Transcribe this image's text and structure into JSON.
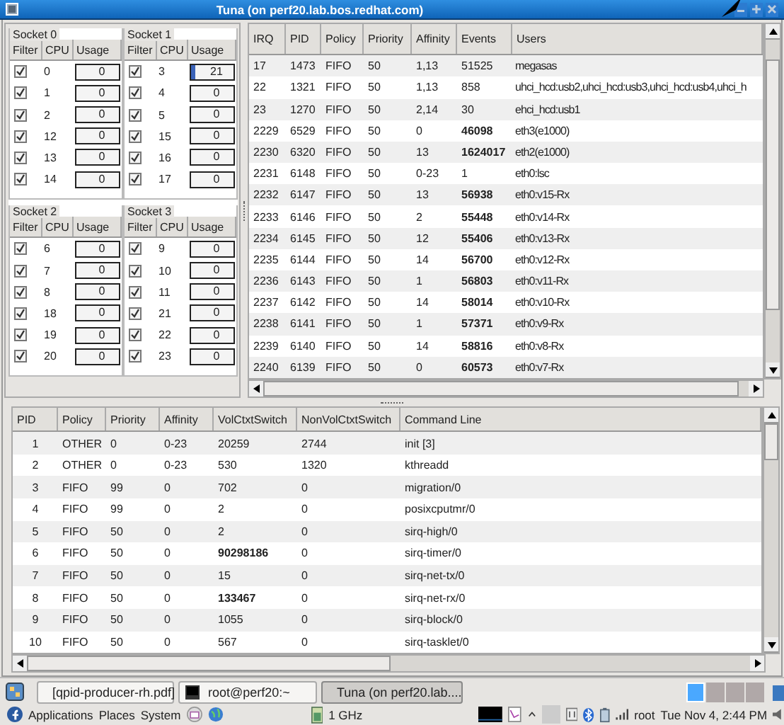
{
  "window": {
    "title": "Tuna (on perf20.lab.bos.redhat.com)"
  },
  "sockets": [
    {
      "label": "Socket 0",
      "columns": [
        "Filter",
        "CPU",
        "Usage"
      ],
      "cpus": [
        {
          "checked": true,
          "cpu": "0",
          "usage": "0"
        },
        {
          "checked": true,
          "cpu": "1",
          "usage": "0"
        },
        {
          "checked": true,
          "cpu": "2",
          "usage": "0"
        },
        {
          "checked": true,
          "cpu": "12",
          "usage": "0"
        },
        {
          "checked": true,
          "cpu": "13",
          "usage": "0"
        },
        {
          "checked": true,
          "cpu": "14",
          "usage": "0"
        }
      ]
    },
    {
      "label": "Socket 1",
      "columns": [
        "Filter",
        "CPU",
        "Usage"
      ],
      "cpus": [
        {
          "checked": true,
          "cpu": "3",
          "usage": "21"
        },
        {
          "checked": true,
          "cpu": "4",
          "usage": "0"
        },
        {
          "checked": true,
          "cpu": "5",
          "usage": "0"
        },
        {
          "checked": true,
          "cpu": "15",
          "usage": "0"
        },
        {
          "checked": true,
          "cpu": "16",
          "usage": "0"
        },
        {
          "checked": true,
          "cpu": "17",
          "usage": "0"
        }
      ]
    },
    {
      "label": "Socket 2",
      "columns": [
        "Filter",
        "CPU",
        "Usage"
      ],
      "cpus": [
        {
          "checked": true,
          "cpu": "6",
          "usage": "0"
        },
        {
          "checked": true,
          "cpu": "7",
          "usage": "0"
        },
        {
          "checked": true,
          "cpu": "8",
          "usage": "0"
        },
        {
          "checked": true,
          "cpu": "18",
          "usage": "0"
        },
        {
          "checked": true,
          "cpu": "19",
          "usage": "0"
        },
        {
          "checked": true,
          "cpu": "20",
          "usage": "0"
        }
      ]
    },
    {
      "label": "Socket 3",
      "columns": [
        "Filter",
        "CPU",
        "Usage"
      ],
      "cpus": [
        {
          "checked": true,
          "cpu": "9",
          "usage": "0"
        },
        {
          "checked": true,
          "cpu": "10",
          "usage": "0"
        },
        {
          "checked": true,
          "cpu": "11",
          "usage": "0"
        },
        {
          "checked": true,
          "cpu": "21",
          "usage": "0"
        },
        {
          "checked": true,
          "cpu": "22",
          "usage": "0"
        },
        {
          "checked": true,
          "cpu": "23",
          "usage": "0"
        }
      ]
    }
  ],
  "irq_table": {
    "columns": [
      "IRQ",
      "PID",
      "Policy",
      "Priority",
      "Affinity",
      "Events",
      "Users"
    ],
    "rows": [
      {
        "cells": [
          "17",
          "1473",
          "FIFO",
          "50",
          "1,13",
          "51525",
          "megasas"
        ],
        "hot": false
      },
      {
        "cells": [
          "22",
          "1321",
          "FIFO",
          "50",
          "1,13",
          "858",
          "uhci_hcd:usb2,uhci_hcd:usb3,uhci_hcd:usb4,uhci_h"
        ],
        "hot": false
      },
      {
        "cells": [
          "23",
          "1270",
          "FIFO",
          "50",
          "2,14",
          "30",
          "ehci_hcd:usb1"
        ],
        "hot": false
      },
      {
        "cells": [
          "2229",
          "6529",
          "FIFO",
          "50",
          "0",
          "46098",
          "eth3(e1000)"
        ],
        "hot": true
      },
      {
        "cells": [
          "2230",
          "6320",
          "FIFO",
          "50",
          "13",
          "1624017",
          "eth2(e1000)"
        ],
        "hot": true
      },
      {
        "cells": [
          "2231",
          "6148",
          "FIFO",
          "50",
          "0-23",
          "1",
          "eth0:lsc"
        ],
        "hot": false
      },
      {
        "cells": [
          "2232",
          "6147",
          "FIFO",
          "50",
          "13",
          "56938",
          "eth0:v15-Rx"
        ],
        "hot": true
      },
      {
        "cells": [
          "2233",
          "6146",
          "FIFO",
          "50",
          "2",
          "55448",
          "eth0:v14-Rx"
        ],
        "hot": true
      },
      {
        "cells": [
          "2234",
          "6145",
          "FIFO",
          "50",
          "12",
          "55406",
          "eth0:v13-Rx"
        ],
        "hot": true
      },
      {
        "cells": [
          "2235",
          "6144",
          "FIFO",
          "50",
          "14",
          "56700",
          "eth0:v12-Rx"
        ],
        "hot": true
      },
      {
        "cells": [
          "2236",
          "6143",
          "FIFO",
          "50",
          "1",
          "56803",
          "eth0:v11-Rx"
        ],
        "hot": true
      },
      {
        "cells": [
          "2237",
          "6142",
          "FIFO",
          "50",
          "14",
          "58014",
          "eth0:v10-Rx"
        ],
        "hot": true
      },
      {
        "cells": [
          "2238",
          "6141",
          "FIFO",
          "50",
          "1",
          "57371",
          "eth0:v9-Rx"
        ],
        "hot": true
      },
      {
        "cells": [
          "2239",
          "6140",
          "FIFO",
          "50",
          "14",
          "58816",
          "eth0:v8-Rx"
        ],
        "hot": true
      },
      {
        "cells": [
          "2240",
          "6139",
          "FIFO",
          "50",
          "0",
          "60573",
          "eth0:v7-Rx"
        ],
        "hot": true
      }
    ]
  },
  "process_table": {
    "columns": [
      "PID",
      "Policy",
      "Priority",
      "Affinity",
      "VolCtxtSwitch",
      "NonVolCtxtSwitch",
      "Command Line"
    ],
    "rows": [
      {
        "cells": [
          "1",
          "OTHER",
          "0",
          "0-23",
          "20259",
          "2744",
          "init [3]"
        ],
        "hot": false
      },
      {
        "cells": [
          "2",
          "OTHER",
          "0",
          "0-23",
          "530",
          "1320",
          "kthreadd"
        ],
        "hot": false
      },
      {
        "cells": [
          "3",
          "FIFO",
          "99",
          "0",
          "702",
          "0",
          "migration/0"
        ],
        "hot": false
      },
      {
        "cells": [
          "4",
          "FIFO",
          "99",
          "0",
          "2",
          "0",
          "posixcputmr/0"
        ],
        "hot": false
      },
      {
        "cells": [
          "5",
          "FIFO",
          "50",
          "0",
          "2",
          "0",
          "sirq-high/0"
        ],
        "hot": false
      },
      {
        "cells": [
          "6",
          "FIFO",
          "50",
          "0",
          "90298186",
          "0",
          "sirq-timer/0"
        ],
        "hot": true
      },
      {
        "cells": [
          "7",
          "FIFO",
          "50",
          "0",
          "15",
          "0",
          "sirq-net-tx/0"
        ],
        "hot": false
      },
      {
        "cells": [
          "8",
          "FIFO",
          "50",
          "0",
          "133467",
          "0",
          "sirq-net-rx/0"
        ],
        "hot": true
      },
      {
        "cells": [
          "9",
          "FIFO",
          "50",
          "0",
          "1055",
          "0",
          "sirq-block/0"
        ],
        "hot": false
      },
      {
        "cells": [
          "10",
          "FIFO",
          "50",
          "0",
          "567",
          "0",
          "sirq-tasklet/0"
        ],
        "hot": false
      }
    ]
  },
  "taskbar": [
    {
      "label": "[qpid-producer-rh.pdf]",
      "selected": false,
      "kind": "document"
    },
    {
      "label": "root@perf20:~",
      "selected": false,
      "kind": "terminal"
    },
    {
      "label": "Tuna (on perf20.lab....",
      "selected": true,
      "kind": "app"
    }
  ],
  "panel": {
    "menus": [
      "Applications",
      "Places",
      "System"
    ],
    "cpu_freq": "1 GHz",
    "user": "root",
    "clock": "Tue Nov  4,  2:44 PM"
  }
}
